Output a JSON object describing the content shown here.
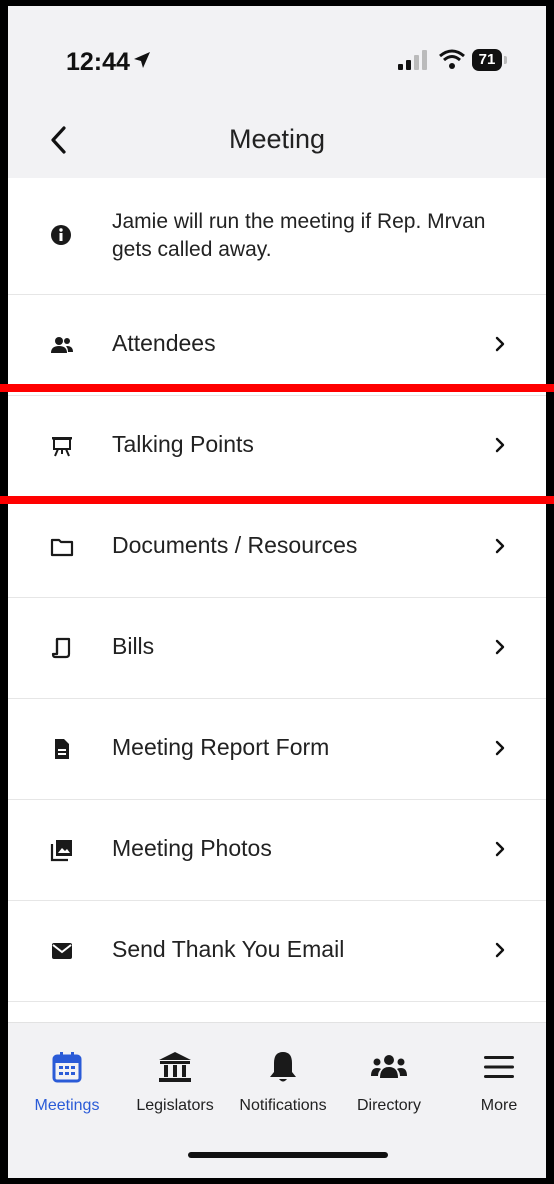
{
  "status_bar": {
    "time": "12:44",
    "battery": "71"
  },
  "header": {
    "title": "Meeting"
  },
  "note": {
    "text": "Jamie will run the meeting if Rep. Mrvan gets called away."
  },
  "items": [
    {
      "label": "Attendees",
      "icon": "people-icon"
    },
    {
      "label": "Talking Points",
      "icon": "presentation-icon"
    },
    {
      "label": "Documents / Resources",
      "icon": "folder-icon"
    },
    {
      "label": "Bills",
      "icon": "scroll-icon"
    },
    {
      "label": "Meeting Report Form",
      "icon": "document-icon"
    },
    {
      "label": "Meeting Photos",
      "icon": "photos-icon"
    },
    {
      "label": "Send Thank You Email",
      "icon": "envelope-icon"
    }
  ],
  "tabs": [
    {
      "label": "Meetings",
      "icon": "calendar-icon",
      "active": true
    },
    {
      "label": "Legislators",
      "icon": "capitol-icon"
    },
    {
      "label": "Notifications",
      "icon": "bell-icon"
    },
    {
      "label": "Directory",
      "icon": "group-icon"
    },
    {
      "label": "More",
      "icon": "menu-icon"
    }
  ],
  "colors": {
    "accent": "#2a5bd7",
    "highlight": "#ff0000"
  }
}
